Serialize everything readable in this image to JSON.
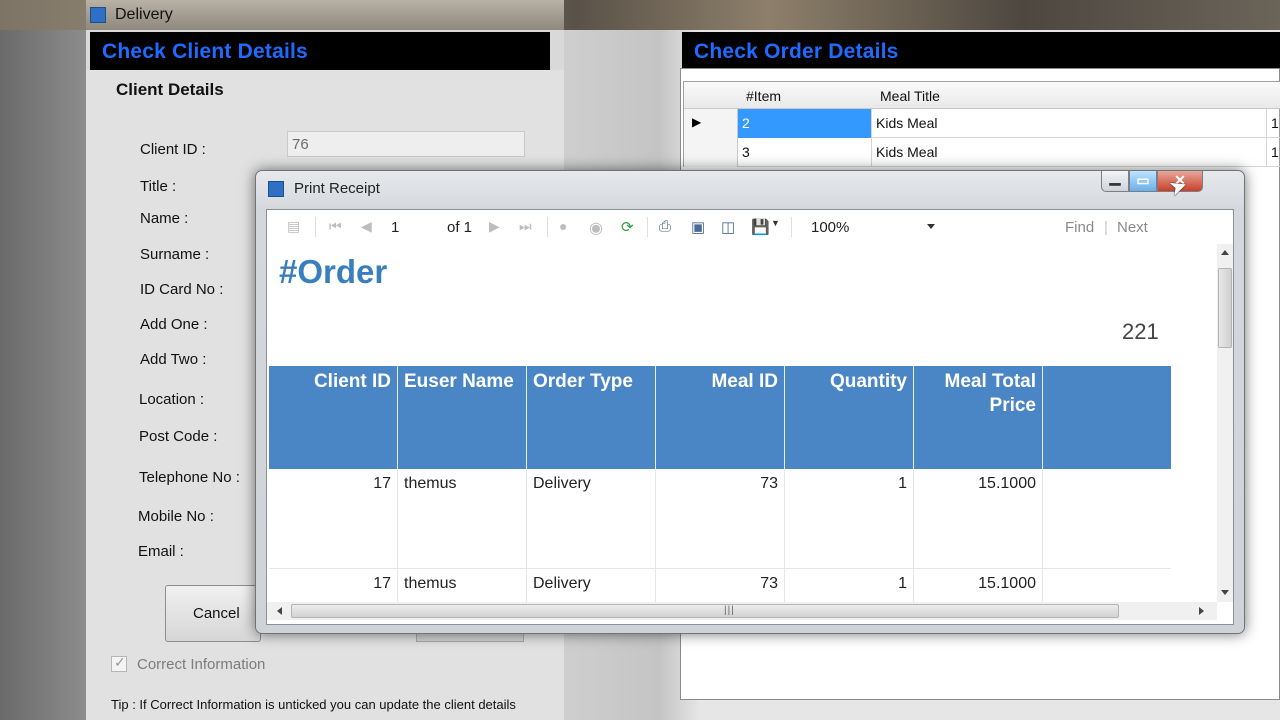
{
  "delivery_window": {
    "title": "Delivery",
    "client_header": "Check Client Details",
    "client_panel_title": "Client Details",
    "labels": {
      "client_id": "Client ID :",
      "title": "Title :",
      "name": "Name :",
      "surname": "Surname :",
      "id_card": "ID Card No :",
      "add_one": "Add One :",
      "add_two": "Add Two :",
      "location": "Location :",
      "post_code": "Post Code :",
      "telephone": "Telephone No :",
      "mobile": "Mobile No :",
      "email": "Email :"
    },
    "client_id_value": "76",
    "cancel_label": "Cancel",
    "correct_info_label": "Correct Information",
    "correct_info_checked": true,
    "tip": "Tip : If Correct Information is unticked you can update the client details",
    "order_header": "Check Order Details",
    "order_grid": {
      "columns": [
        "#Item",
        "Meal Title"
      ],
      "rows": [
        {
          "item": "2",
          "meal": "Kids Meal",
          "extra": "1"
        },
        {
          "item": "3",
          "meal": "Kids Meal",
          "extra": "1"
        }
      ]
    }
  },
  "print_dialog": {
    "title": "Print Receipt",
    "toolbar": {
      "page": "1",
      "of_pages": "of 1",
      "zoom": "100%",
      "find": "Find",
      "next": "Next"
    },
    "report": {
      "title": "#Order",
      "number": "221",
      "columns": [
        "Client ID",
        "Euser Name",
        "Order Type",
        "Meal ID",
        "Quantity",
        "Meal Total Price"
      ],
      "rows": [
        [
          "17",
          "themus",
          "Delivery",
          "73",
          "1",
          "15.1000"
        ],
        [
          "17",
          "themus",
          "Delivery",
          "73",
          "1",
          "15.1000"
        ]
      ]
    }
  },
  "colors": {
    "header_text": "#1f6bff",
    "report_header_bg": "#4a86c5",
    "report_title": "#3a7fbd",
    "selection": "#3399ff"
  }
}
